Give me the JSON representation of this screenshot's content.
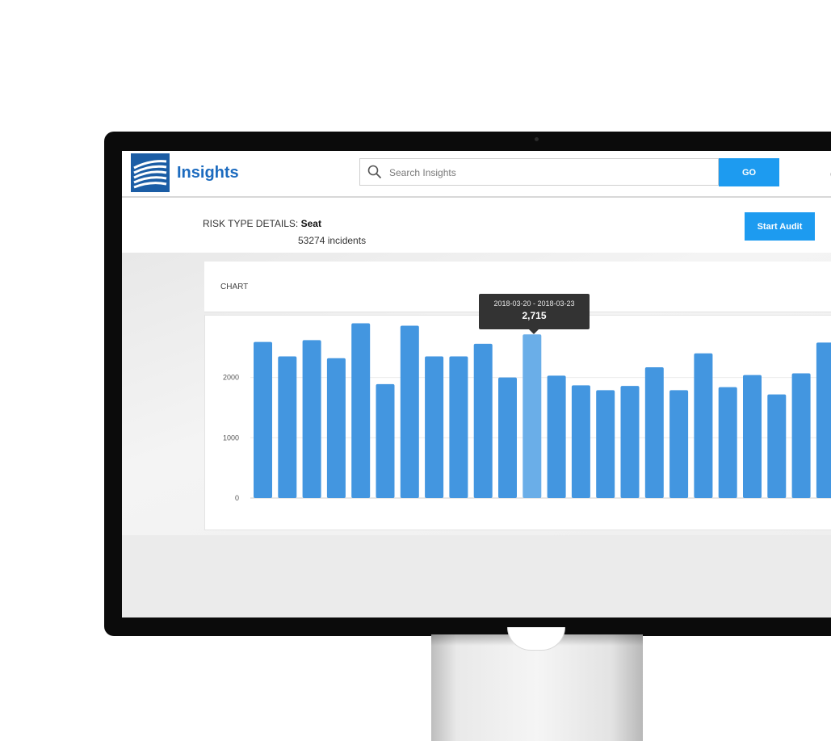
{
  "app": {
    "title": "Insights"
  },
  "search": {
    "placeholder": "Search Insights",
    "go_label": "GO"
  },
  "details": {
    "label": "RISK TYPE DETAILS: ",
    "risk_type": "Seat",
    "incidents": "53274 incidents",
    "audit_label": "Start Audit"
  },
  "chart_heading": "CHART",
  "tooltip": {
    "range": "2018-03-20 - 2018-03-23",
    "value": "2,715"
  },
  "colors": {
    "bar": "#4396e0",
    "bar_highlight": "#6aaee8",
    "accent": "#1d9bf0"
  },
  "chart_data": {
    "type": "bar",
    "values": [
      2590,
      2350,
      2620,
      2320,
      2900,
      1890,
      2860,
      2350,
      2350,
      2560,
      2000,
      2715,
      2030,
      1870,
      1790,
      1860,
      2170,
      1790,
      2400,
      1840,
      2040,
      1720,
      2070,
      2580
    ],
    "highlight_index": 11,
    "yticks": [
      0,
      1000,
      2000
    ],
    "ylim": [
      0,
      3000
    ],
    "grid": true
  }
}
